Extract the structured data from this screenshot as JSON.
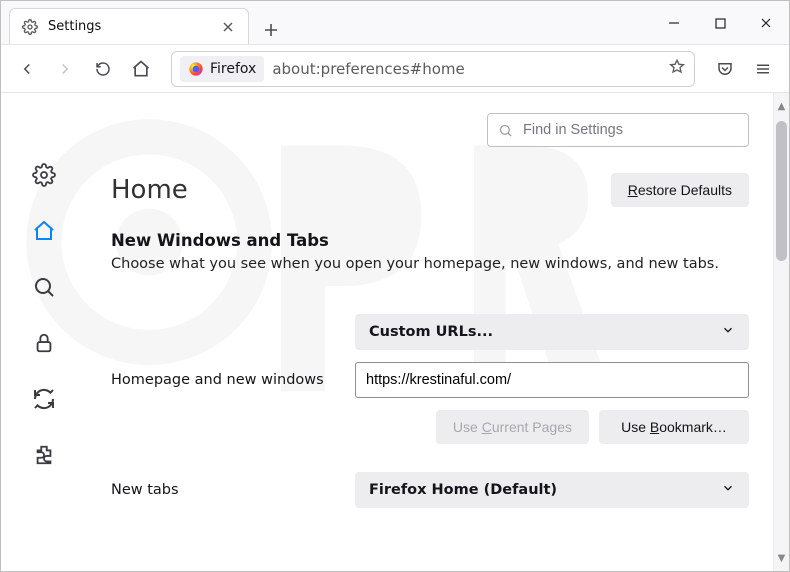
{
  "window": {
    "tab_title": "Settings",
    "url_prefix": "Firefox",
    "url": "about:preferences#home"
  },
  "search": {
    "placeholder": "Find in Settings"
  },
  "headline": {
    "title": "Home",
    "restore_label": "Restore Defaults",
    "restore_ak": "R"
  },
  "section": {
    "title": "New Windows and Tabs",
    "desc": "Choose what you see when you open your homepage, new windows, and new tabs."
  },
  "homepage": {
    "label": "Homepage and new windows",
    "dropdown_value": "Custom URLs...",
    "url_value": "https://krestinaful.com/",
    "use_current_label": "Use Current Pages",
    "use_current_ak": "C",
    "use_bookmark_label": "Use Bookmark…",
    "use_bookmark_ak": "B"
  },
  "newtabs": {
    "label": "New tabs",
    "dropdown_value": "Firefox Home (Default)"
  },
  "icons": {
    "tab": "gear-icon",
    "sidebar": [
      "general",
      "home",
      "search",
      "privacy",
      "sync",
      "extensions"
    ]
  }
}
